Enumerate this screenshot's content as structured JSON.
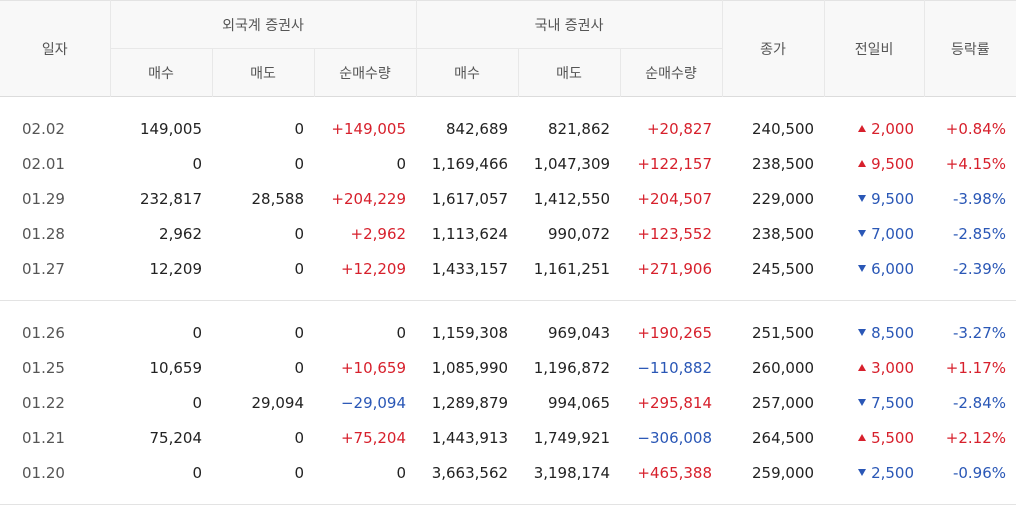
{
  "header": {
    "date": "일자",
    "foreign_group": "외국계 증권사",
    "domestic_group": "국내 증권사",
    "buy": "매수",
    "sell": "매도",
    "net": "순매수량",
    "close": "종가",
    "change": "전일비",
    "rate": "등락률"
  },
  "colors": {
    "rise": "#d7202c",
    "fall": "#2a57b6",
    "header_bg": "#f8f8f8"
  },
  "groups": [
    [
      {
        "date": "02.02",
        "f_buy": "149,005",
        "f_sell": "0",
        "f_net": "+149,005",
        "d_buy": "842,689",
        "d_sell": "821,862",
        "d_net": "+20,827",
        "close": "240,500",
        "dir": "up",
        "change": "2,000",
        "rate": "+0.84%"
      },
      {
        "date": "02.01",
        "f_buy": "0",
        "f_sell": "0",
        "f_net": "0",
        "d_buy": "1,169,466",
        "d_sell": "1,047,309",
        "d_net": "+122,157",
        "close": "238,500",
        "dir": "up",
        "change": "9,500",
        "rate": "+4.15%"
      },
      {
        "date": "01.29",
        "f_buy": "232,817",
        "f_sell": "28,588",
        "f_net": "+204,229",
        "d_buy": "1,617,057",
        "d_sell": "1,412,550",
        "d_net": "+204,507",
        "close": "229,000",
        "dir": "down",
        "change": "9,500",
        "rate": "-3.98%"
      },
      {
        "date": "01.28",
        "f_buy": "2,962",
        "f_sell": "0",
        "f_net": "+2,962",
        "d_buy": "1,113,624",
        "d_sell": "990,072",
        "d_net": "+123,552",
        "close": "238,500",
        "dir": "down",
        "change": "7,000",
        "rate": "-2.85%"
      },
      {
        "date": "01.27",
        "f_buy": "12,209",
        "f_sell": "0",
        "f_net": "+12,209",
        "d_buy": "1,433,157",
        "d_sell": "1,161,251",
        "d_net": "+271,906",
        "close": "245,500",
        "dir": "down",
        "change": "6,000",
        "rate": "-2.39%"
      }
    ],
    [
      {
        "date": "01.26",
        "f_buy": "0",
        "f_sell": "0",
        "f_net": "0",
        "d_buy": "1,159,308",
        "d_sell": "969,043",
        "d_net": "+190,265",
        "close": "251,500",
        "dir": "down",
        "change": "8,500",
        "rate": "-3.27%"
      },
      {
        "date": "01.25",
        "f_buy": "10,659",
        "f_sell": "0",
        "f_net": "+10,659",
        "d_buy": "1,085,990",
        "d_sell": "1,196,872",
        "d_net": "−110,882",
        "close": "260,000",
        "dir": "up",
        "change": "3,000",
        "rate": "+1.17%"
      },
      {
        "date": "01.22",
        "f_buy": "0",
        "f_sell": "29,094",
        "f_net": "−29,094",
        "d_buy": "1,289,879",
        "d_sell": "994,065",
        "d_net": "+295,814",
        "close": "257,000",
        "dir": "down",
        "change": "7,500",
        "rate": "-2.84%"
      },
      {
        "date": "01.21",
        "f_buy": "75,204",
        "f_sell": "0",
        "f_net": "+75,204",
        "d_buy": "1,443,913",
        "d_sell": "1,749,921",
        "d_net": "−306,008",
        "close": "264,500",
        "dir": "up",
        "change": "5,500",
        "rate": "+2.12%"
      },
      {
        "date": "01.20",
        "f_buy": "0",
        "f_sell": "0",
        "f_net": "0",
        "d_buy": "3,663,562",
        "d_sell": "3,198,174",
        "d_net": "+465,388",
        "close": "259,000",
        "dir": "down",
        "change": "2,500",
        "rate": "-0.96%"
      }
    ]
  ]
}
